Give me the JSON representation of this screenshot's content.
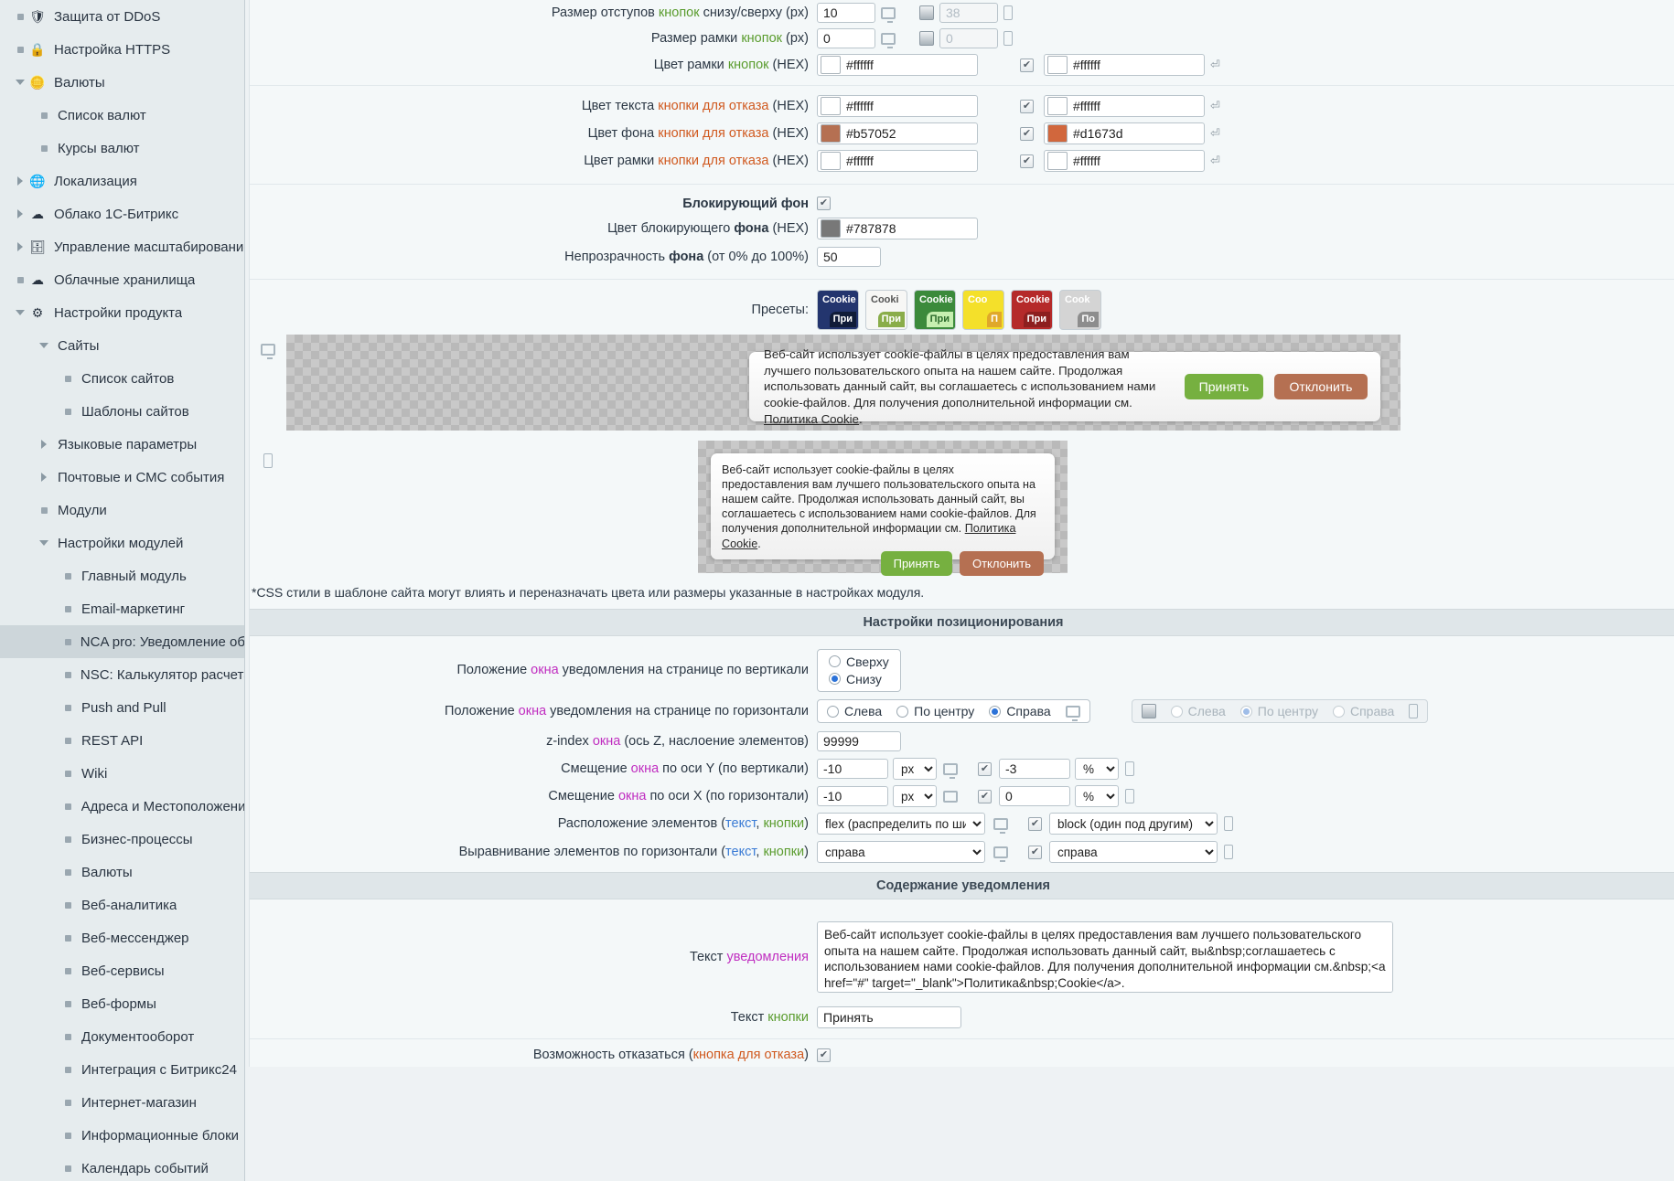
{
  "sidebar": {
    "items": [
      {
        "label": "Защита от DDoS",
        "level": 1,
        "twisty": "bullet",
        "icon": "shield-icon",
        "selected": false
      },
      {
        "label": "Настройка HTTPS",
        "level": 1,
        "twisty": "bullet",
        "icon": "lock-icon",
        "selected": false
      },
      {
        "label": "Валюты",
        "level": 1,
        "twisty": "down",
        "icon": "coin-icon",
        "selected": false
      },
      {
        "label": "Список валют",
        "level": 2,
        "twisty": "bullet",
        "icon": "",
        "selected": false
      },
      {
        "label": "Курсы валют",
        "level": 2,
        "twisty": "bullet",
        "icon": "",
        "selected": false
      },
      {
        "label": "Локализация",
        "level": 1,
        "twisty": "right",
        "icon": "globe-icon",
        "selected": false
      },
      {
        "label": "Облако 1С-Битрикс",
        "level": 1,
        "twisty": "right",
        "icon": "cloud-icon",
        "selected": false
      },
      {
        "label": "Управление масштабированием",
        "level": 1,
        "twisty": "right",
        "icon": "server-icon",
        "selected": false
      },
      {
        "label": "Облачные хранилища",
        "level": 1,
        "twisty": "bullet",
        "icon": "cloud-store-icon",
        "selected": false
      },
      {
        "label": "Настройки продукта",
        "level": 1,
        "twisty": "down",
        "icon": "gear-icon",
        "selected": false
      },
      {
        "label": "Сайты",
        "level": 2,
        "twisty": "down",
        "icon": "",
        "selected": false
      },
      {
        "label": "Список сайтов",
        "level": 3,
        "twisty": "bullet",
        "icon": "",
        "selected": false
      },
      {
        "label": "Шаблоны сайтов",
        "level": 3,
        "twisty": "bullet",
        "icon": "",
        "selected": false
      },
      {
        "label": "Языковые параметры",
        "level": 2,
        "twisty": "right",
        "icon": "",
        "selected": false
      },
      {
        "label": "Почтовые и СМС события",
        "level": 2,
        "twisty": "right",
        "icon": "",
        "selected": false
      },
      {
        "label": "Модули",
        "level": 2,
        "twisty": "bullet",
        "icon": "",
        "selected": false
      },
      {
        "label": "Настройки модулей",
        "level": 2,
        "twisty": "down",
        "icon": "",
        "selected": false
      },
      {
        "label": "Главный модуль",
        "level": 3,
        "twisty": "bullet",
        "icon": "",
        "selected": false
      },
      {
        "label": "Email-маркетинг",
        "level": 3,
        "twisty": "bullet",
        "icon": "",
        "selected": false
      },
      {
        "label": "NCA pro: Уведомление об испо",
        "level": 3,
        "twisty": "bullet",
        "icon": "",
        "selected": true
      },
      {
        "label": "NSC: Калькулятор расчета тов",
        "level": 3,
        "twisty": "bullet",
        "icon": "",
        "selected": false
      },
      {
        "label": "Push and Pull",
        "level": 3,
        "twisty": "bullet",
        "icon": "",
        "selected": false
      },
      {
        "label": "REST API",
        "level": 3,
        "twisty": "bullet",
        "icon": "",
        "selected": false
      },
      {
        "label": "Wiki",
        "level": 3,
        "twisty": "bullet",
        "icon": "",
        "selected": false
      },
      {
        "label": "Адреса и Местоположения",
        "level": 3,
        "twisty": "bullet",
        "icon": "",
        "selected": false
      },
      {
        "label": "Бизнес-процессы",
        "level": 3,
        "twisty": "bullet",
        "icon": "",
        "selected": false
      },
      {
        "label": "Валюты",
        "level": 3,
        "twisty": "bullet",
        "icon": "",
        "selected": false
      },
      {
        "label": "Веб-аналитика",
        "level": 3,
        "twisty": "bullet",
        "icon": "",
        "selected": false
      },
      {
        "label": "Веб-мессенджер",
        "level": 3,
        "twisty": "bullet",
        "icon": "",
        "selected": false
      },
      {
        "label": "Веб-сервисы",
        "level": 3,
        "twisty": "bullet",
        "icon": "",
        "selected": false
      },
      {
        "label": "Веб-формы",
        "level": 3,
        "twisty": "bullet",
        "icon": "",
        "selected": false
      },
      {
        "label": "Документооборот",
        "level": 3,
        "twisty": "bullet",
        "icon": "",
        "selected": false
      },
      {
        "label": "Интеграция с Битрикс24",
        "level": 3,
        "twisty": "bullet",
        "icon": "",
        "selected": false
      },
      {
        "label": "Интернет-магазин",
        "level": 3,
        "twisty": "bullet",
        "icon": "",
        "selected": false
      },
      {
        "label": "Информационные блоки",
        "level": 3,
        "twisty": "bullet",
        "icon": "",
        "selected": false
      },
      {
        "label": "Календарь событий",
        "level": 3,
        "twisty": "bullet",
        "icon": "",
        "selected": false
      }
    ]
  },
  "form": {
    "rows": {
      "padding": {
        "l1": "Размер отступов ",
        "acc": "кнопок",
        "l2": " снизу/сверху (px)",
        "desktop": "10",
        "mobile": "38"
      },
      "border_size": {
        "l1": "Размер рамки ",
        "acc": "кнопок",
        "l2": " (px)",
        "desktop": "0",
        "mobile": "0"
      },
      "border_color": {
        "l1": "Цвет рамки ",
        "acc": "кнопок",
        "l2": " (HEX)",
        "desktop": "#ffffff",
        "desktop_sw": "#ffffff",
        "mobile": "#ffffff",
        "mobile_sw": "#ffffff"
      },
      "decline_text": {
        "l1": "Цвет текста ",
        "acc": "кнопки для отказа",
        "l2": " (HEX)",
        "desktop": "#ffffff",
        "desktop_sw": "#ffffff",
        "mobile": "#ffffff",
        "mobile_sw": "#ffffff"
      },
      "decline_bg": {
        "l1": "Цвет фона ",
        "acc": "кнопки для отказа",
        "l2": " (HEX)",
        "desktop": "#b57052",
        "desktop_sw": "#b57052",
        "mobile": "#d1673d",
        "mobile_sw": "#d1673d"
      },
      "decline_border": {
        "l1": "Цвет рамки ",
        "acc": "кнопки для отказа",
        "l2": " (HEX)",
        "desktop": "#ffffff",
        "desktop_sw": "#ffffff",
        "mobile": "#ffffff",
        "mobile_sw": "#ffffff"
      },
      "block_bg": {
        "label": "Блокирующий фон",
        "checked": true
      },
      "block_bg_color": {
        "l1": "Цвет блокирующего ",
        "acc": "фона",
        "l2": " (HEX)",
        "value": "#787878",
        "sw": "#787878"
      },
      "opacity": {
        "l1": "Непрозрачность ",
        "acc": "фона",
        "l2": " (от 0% до 100%)",
        "value": "50"
      },
      "presets_label": "Пресеты:"
    },
    "presets": [
      {
        "bg": "#23356e",
        "text_color": "#ffffff",
        "btn_bg": "#101c38",
        "btn_text": "#ffffff",
        "title": "Cookie",
        "btn": "При"
      },
      {
        "bg": "#f7f7f5",
        "text_color": "#555555",
        "btn_bg": "#8aad4a",
        "btn_text": "#ffffff",
        "title": "Cooki",
        "btn": "При"
      },
      {
        "bg": "#3b8a3b",
        "text_color": "#ffffff",
        "btn_bg": "#c6efb0",
        "btn_text": "#2c6b2c",
        "title": "Cookie",
        "btn": "При"
      },
      {
        "bg": "#f4e02a",
        "text_color": "#ffffff",
        "btn_bg": "#e0a82a",
        "btn_text": "#ffffff",
        "title": "Coo",
        "btn": "П"
      },
      {
        "bg": "#b52a2a",
        "text_color": "#ffffff",
        "btn_bg": "#8d1f1f",
        "btn_text": "#ffffff",
        "title": "Cookie",
        "btn": "При"
      },
      {
        "bg": "#d4d4d4",
        "text_color": "#ffffff",
        "btn_bg": "#8d8d8d",
        "btn_text": "#ffffff",
        "title": "Cook",
        "btn": "По"
      }
    ],
    "preview": {
      "desktop_icon": "monitor-icon",
      "mobile_icon": "mobile-icon",
      "text_part1": "Веб-сайт использует cookie-файлы в целях предоставления вам лучшего пользовательского опыта на нашем сайте. Продолжая использовать данный сайт, вы соглашаетесь с использованием нами cookie-файлов. Для получения дополнительной информации см. ",
      "link": "Политика Cookie",
      "text_part2": ".",
      "accept": "Принять",
      "decline": "Отклонить",
      "accept_bg": "#76b040",
      "decline_bg": "#b57052"
    },
    "css_note": "*CSS стили в шаблоне сайта могут влиять и переназначать цвета или размеры указанные в настройках модуля.",
    "section_positioning": "Настройки позиционирования",
    "section_content": "Содержание уведомления",
    "vertical": {
      "l1": "Положение ",
      "acc": "окна",
      "l2": " уведомления на странице по вертикали",
      "options": [
        "Сверху",
        "Снизу"
      ],
      "selected": "Снизу"
    },
    "horizontal": {
      "l1": "Положение ",
      "acc": "окна",
      "l2": " уведомления на странице по горизонтали",
      "options": [
        "Слева",
        "По центру",
        "Справа"
      ],
      "selected_desktop": "Справа",
      "selected_mobile": "По центру"
    },
    "zindex": {
      "l1": "z-index ",
      "acc": "окна",
      "l2": " (ось Z, наслоение элементов)",
      "value": "99999"
    },
    "offsetY": {
      "l1": "Смещение ",
      "acc": "окна",
      "l2": " по оси Y (по вертикали)",
      "desktop": "-10",
      "desktop_unit": "px",
      "mobile": "-3",
      "mobile_unit": "%",
      "mobile_enabled": true
    },
    "offsetX": {
      "l1": "Смещение ",
      "acc": "окна",
      "l2": " по оси X (по горизонтали)",
      "desktop": "-10",
      "desktop_unit": "px",
      "mobile": "0",
      "mobile_unit": "%",
      "mobile_enabled": true
    },
    "layout": {
      "l1": "Расположение элементов (",
      "acc1": "текст",
      "sep": ", ",
      "acc2": "кнопки",
      "l2": ")",
      "desktop": "flex (распределить по ширине)",
      "mobile": "block (один под другим)",
      "mobile_enabled": true
    },
    "align": {
      "l1": "Выравнивание элементов по горизонтали (",
      "acc1": "текст",
      "sep": ", ",
      "acc2": "кнопки",
      "l2": ")",
      "desktop": "справа",
      "mobile": "справа",
      "mobile_enabled": true
    },
    "notice_text": {
      "l1": "Текст ",
      "acc": "уведомления",
      "value": "Веб-сайт использует cookie-файлы в целях предоставления вам лучшего пользовательского опыта на нашем сайте. Продолжая использовать данный сайт, вы&nbsp;соглашаетесь с использованием нами cookie-файлов. Для получения дополнительной информации см.&nbsp;<a href=\"#\" target=\"_blank\">Политика&nbsp;Cookie</a>."
    },
    "button_text": {
      "l1": "Текст ",
      "acc": "кнопки",
      "value": "Принять"
    },
    "can_decline": {
      "l1": "Возможность отказаться (",
      "acc": "кнопка для отказа",
      "l2": ")",
      "checked": true
    }
  },
  "colors": {
    "accent_green": "#5a9c2e",
    "accent_orange": "#d0591f",
    "accent_magenta": "#c02ec0",
    "accent_blue": "#3a7bd5"
  }
}
